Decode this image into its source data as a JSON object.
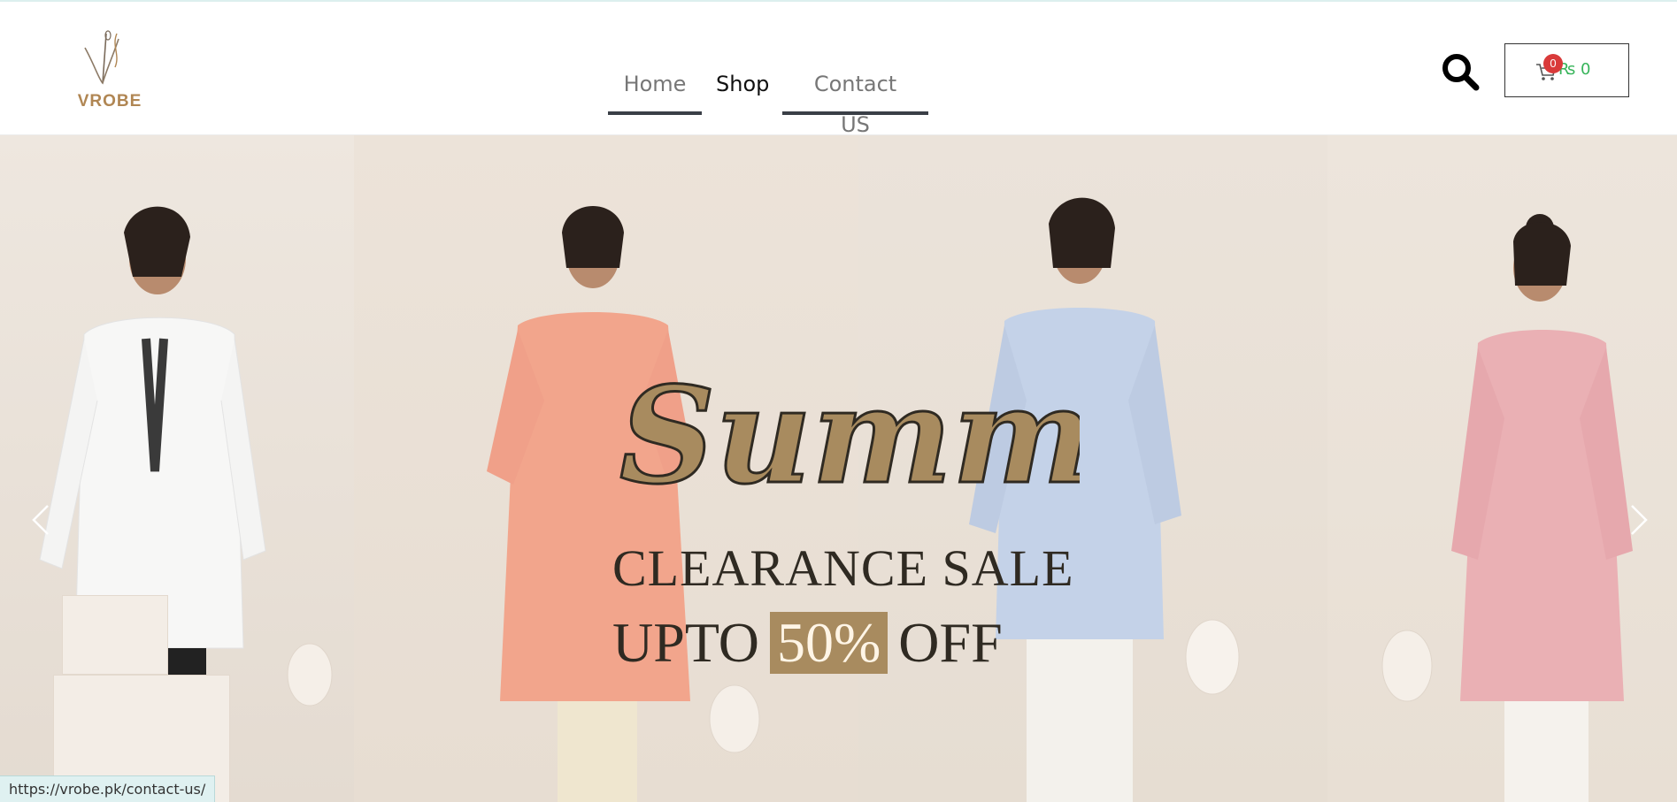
{
  "brand": {
    "name": "VROBE",
    "logo_color": "#b08653"
  },
  "nav": {
    "items": [
      {
        "label": "Home",
        "active": false
      },
      {
        "label": "Shop",
        "active": true
      },
      {
        "label": "Contact US",
        "active": false
      }
    ]
  },
  "header": {
    "search_icon": "search-icon",
    "cart": {
      "badge_count": "0",
      "amount": "₨ 0",
      "icon": "cart-icon"
    }
  },
  "hero": {
    "promo": {
      "script_title": "Summer",
      "line1": "CLEARANCE SALE",
      "line2_prefix": "UPTO",
      "line2_highlight": "50%",
      "line2_suffix": "OFF"
    },
    "prev_icon": "chevron-left-icon",
    "next_icon": "chevron-right-icon",
    "colors": {
      "accent": "#a88b5f",
      "text": "#2f2a22"
    }
  },
  "status_bar": {
    "url": "https://vrobe.pk/contact-us/"
  }
}
